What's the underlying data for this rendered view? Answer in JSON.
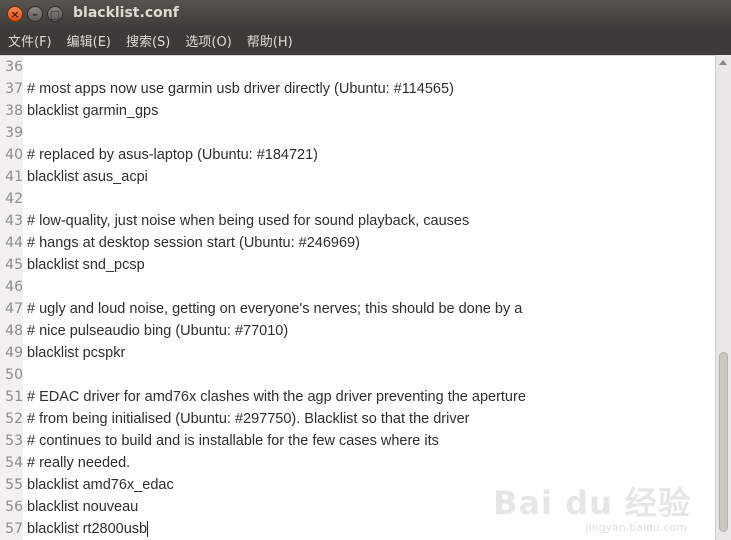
{
  "window": {
    "title": "blacklist.conf"
  },
  "menubar": {
    "items": [
      "文件(F)",
      "编辑(E)",
      "搜索(S)",
      "选项(O)",
      "帮助(H)"
    ]
  },
  "editor": {
    "lines": [
      {
        "num": "36",
        "text": ""
      },
      {
        "num": "37",
        "text": "# most apps now use garmin usb driver directly (Ubuntu: #114565)"
      },
      {
        "num": "38",
        "text": "blacklist garmin_gps"
      },
      {
        "num": "39",
        "text": ""
      },
      {
        "num": "40",
        "text": "# replaced by asus-laptop (Ubuntu: #184721)"
      },
      {
        "num": "41",
        "text": "blacklist asus_acpi"
      },
      {
        "num": "42",
        "text": ""
      },
      {
        "num": "43",
        "text": "# low-quality, just noise when being used for sound playback, causes"
      },
      {
        "num": "44",
        "text": "# hangs at desktop session start (Ubuntu: #246969)"
      },
      {
        "num": "45",
        "text": "blacklist snd_pcsp"
      },
      {
        "num": "46",
        "text": ""
      },
      {
        "num": "47",
        "text": "# ugly and loud noise, getting on everyone's nerves; this should be done by a"
      },
      {
        "num": "48",
        "text": "# nice pulseaudio bing (Ubuntu: #77010)"
      },
      {
        "num": "49",
        "text": "blacklist pcspkr"
      },
      {
        "num": "50",
        "text": ""
      },
      {
        "num": "51",
        "text": "# EDAC driver for amd76x clashes with the agp driver preventing the aperture"
      },
      {
        "num": "52",
        "text": "# from being initialised (Ubuntu: #297750). Blacklist so that the driver"
      },
      {
        "num": "53",
        "text": "# continues to build and is installable for the few cases where its"
      },
      {
        "num": "54",
        "text": "# really needed."
      },
      {
        "num": "55",
        "text": "blacklist amd76x_edac"
      },
      {
        "num": "56",
        "text": "blacklist nouveau"
      },
      {
        "num": "57",
        "text": "blacklist rt2800usb"
      }
    ]
  },
  "watermark": {
    "main": "Bai du 经验",
    "sub": "jingyan.baidu.com"
  }
}
